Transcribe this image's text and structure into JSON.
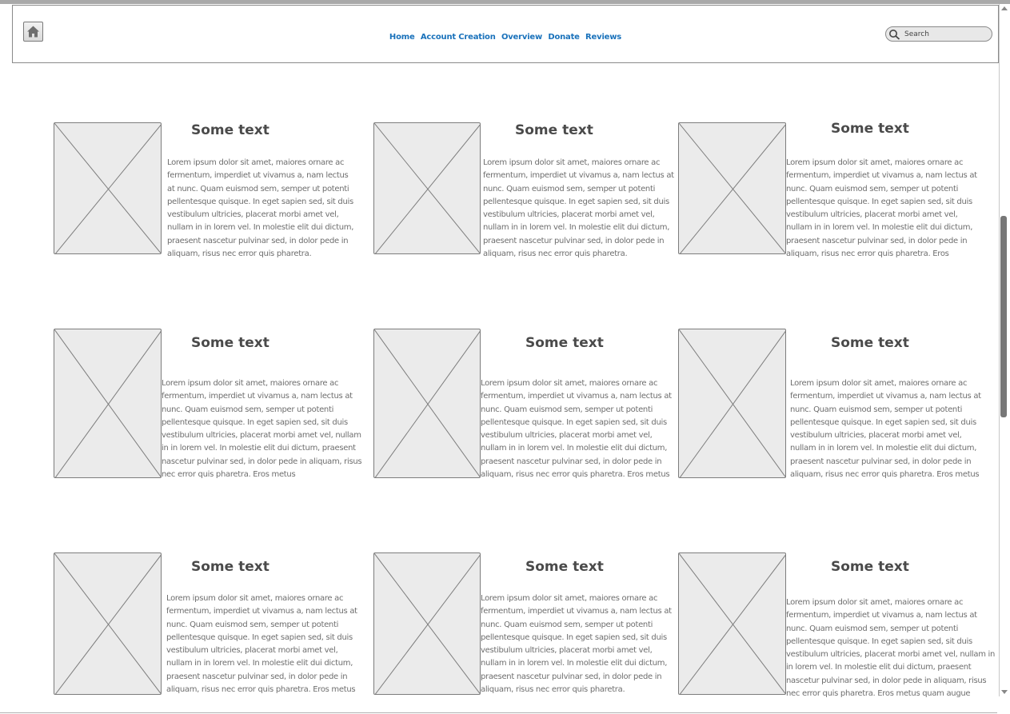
{
  "nav": {
    "home_icon": "home-icon",
    "links": [
      "Home",
      "Account Creation",
      "Overview",
      "Donate",
      "Reviews"
    ],
    "search_placeholder": "Search"
  },
  "cards": [
    {
      "title": "Some text",
      "body": "Lorem ipsum dolor sit amet, maiores ornare ac fermentum, imperdiet ut vivamus a, nam lectus at nunc. Quam euismod sem, semper ut potenti pellentesque quisque. In eget sapien sed, sit duis vestibulum ultricies, placerat morbi amet vel, nullam in in lorem vel. In molestie elit dui dictum, praesent nascetur pulvinar sed, in dolor pede in aliquam, risus nec error quis pharetra."
    },
    {
      "title": "Some text",
      "body": "Lorem ipsum dolor sit amet, maiores ornare ac fermentum, imperdiet ut vivamus a, nam lectus at nunc. Quam euismod sem, semper ut potenti pellentesque quisque. In eget sapien sed, sit duis vestibulum ultricies, placerat morbi amet vel, nullam in in lorem vel. In molestie elit dui dictum, praesent nascetur pulvinar sed, in dolor pede in aliquam, risus nec error quis pharetra."
    },
    {
      "title": "Some text",
      "body": "Lorem ipsum dolor sit amet, maiores ornare ac fermentum, imperdiet ut vivamus a, nam lectus at nunc. Quam euismod sem, semper ut potenti pellentesque quisque. In eget sapien sed, sit duis vestibulum ultricies, placerat morbi amet vel, nullam in in lorem vel. In molestie elit dui dictum, praesent nascetur pulvinar sed, in dolor pede in aliquam, risus nec error quis pharetra. Eros"
    },
    {
      "title": "Some text",
      "body": "Lorem ipsum dolor sit amet, maiores ornare ac fermentum, imperdiet ut vivamus a, nam lectus at nunc. Quam euismod sem, semper ut potenti pellentesque quisque. In eget sapien sed, sit duis vestibulum ultricies, placerat morbi amet vel, nullam in in lorem vel. In molestie elit dui dictum, praesent nascetur pulvinar sed, in dolor pede in aliquam, risus nec error quis pharetra. Eros metus"
    },
    {
      "title": "Some text",
      "body": "Lorem ipsum dolor sit amet, maiores ornare ac fermentum, imperdiet ut vivamus a, nam lectus at nunc. Quam euismod sem, semper ut potenti pellentesque quisque. In eget sapien sed, sit duis vestibulum ultricies, placerat morbi amet vel, nullam in in lorem vel. In molestie elit dui dictum, praesent nascetur pulvinar sed, in dolor pede in aliquam, risus nec error quis pharetra. Eros metus"
    },
    {
      "title": "Some text",
      "body": "Lorem ipsum dolor sit amet, maiores ornare ac fermentum, imperdiet ut vivamus a, nam lectus at nunc. Quam euismod sem, semper ut potenti pellentesque quisque. In eget sapien sed, sit duis vestibulum ultricies, placerat morbi amet vel, nullam in in lorem vel. In molestie elit dui dictum, praesent nascetur pulvinar sed, in dolor pede in aliquam, risus nec error quis pharetra. Eros metus"
    },
    {
      "title": "Some text",
      "body": "Lorem ipsum dolor sit amet, maiores ornare ac fermentum, imperdiet ut vivamus a, nam lectus at nunc. Quam euismod sem, semper ut potenti pellentesque quisque. In eget sapien sed, sit duis vestibulum ultricies, placerat morbi amet vel, nullam in in lorem vel. In molestie elit dui dictum, praesent nascetur pulvinar sed, in dolor pede in aliquam, risus nec error quis pharetra. Eros metus"
    },
    {
      "title": "Some text",
      "body": "Lorem ipsum dolor sit amet, maiores ornare ac fermentum, imperdiet ut vivamus a, nam lectus at nunc. Quam euismod sem, semper ut potenti pellentesque quisque. In eget sapien sed, sit duis vestibulum ultricies, placerat morbi amet vel, nullam in in lorem vel. In molestie elit dui dictum, praesent nascetur pulvinar sed, in dolor pede in aliquam, risus nec error quis pharetra."
    },
    {
      "title": "Some text",
      "body": "Lorem ipsum dolor sit amet, maiores ornare ac fermentum, imperdiet ut vivamus a, nam lectus at nunc. Quam euismod sem, semper ut potenti pellentesque quisque. In eget sapien sed, sit duis vestibulum ultricies, placerat morbi amet vel, nullam in in lorem vel. In molestie elit dui dictum, praesent nascetur pulvinar sed, in dolor pede in aliquam, risus nec error quis pharetra. Eros metus quam augue"
    }
  ]
}
